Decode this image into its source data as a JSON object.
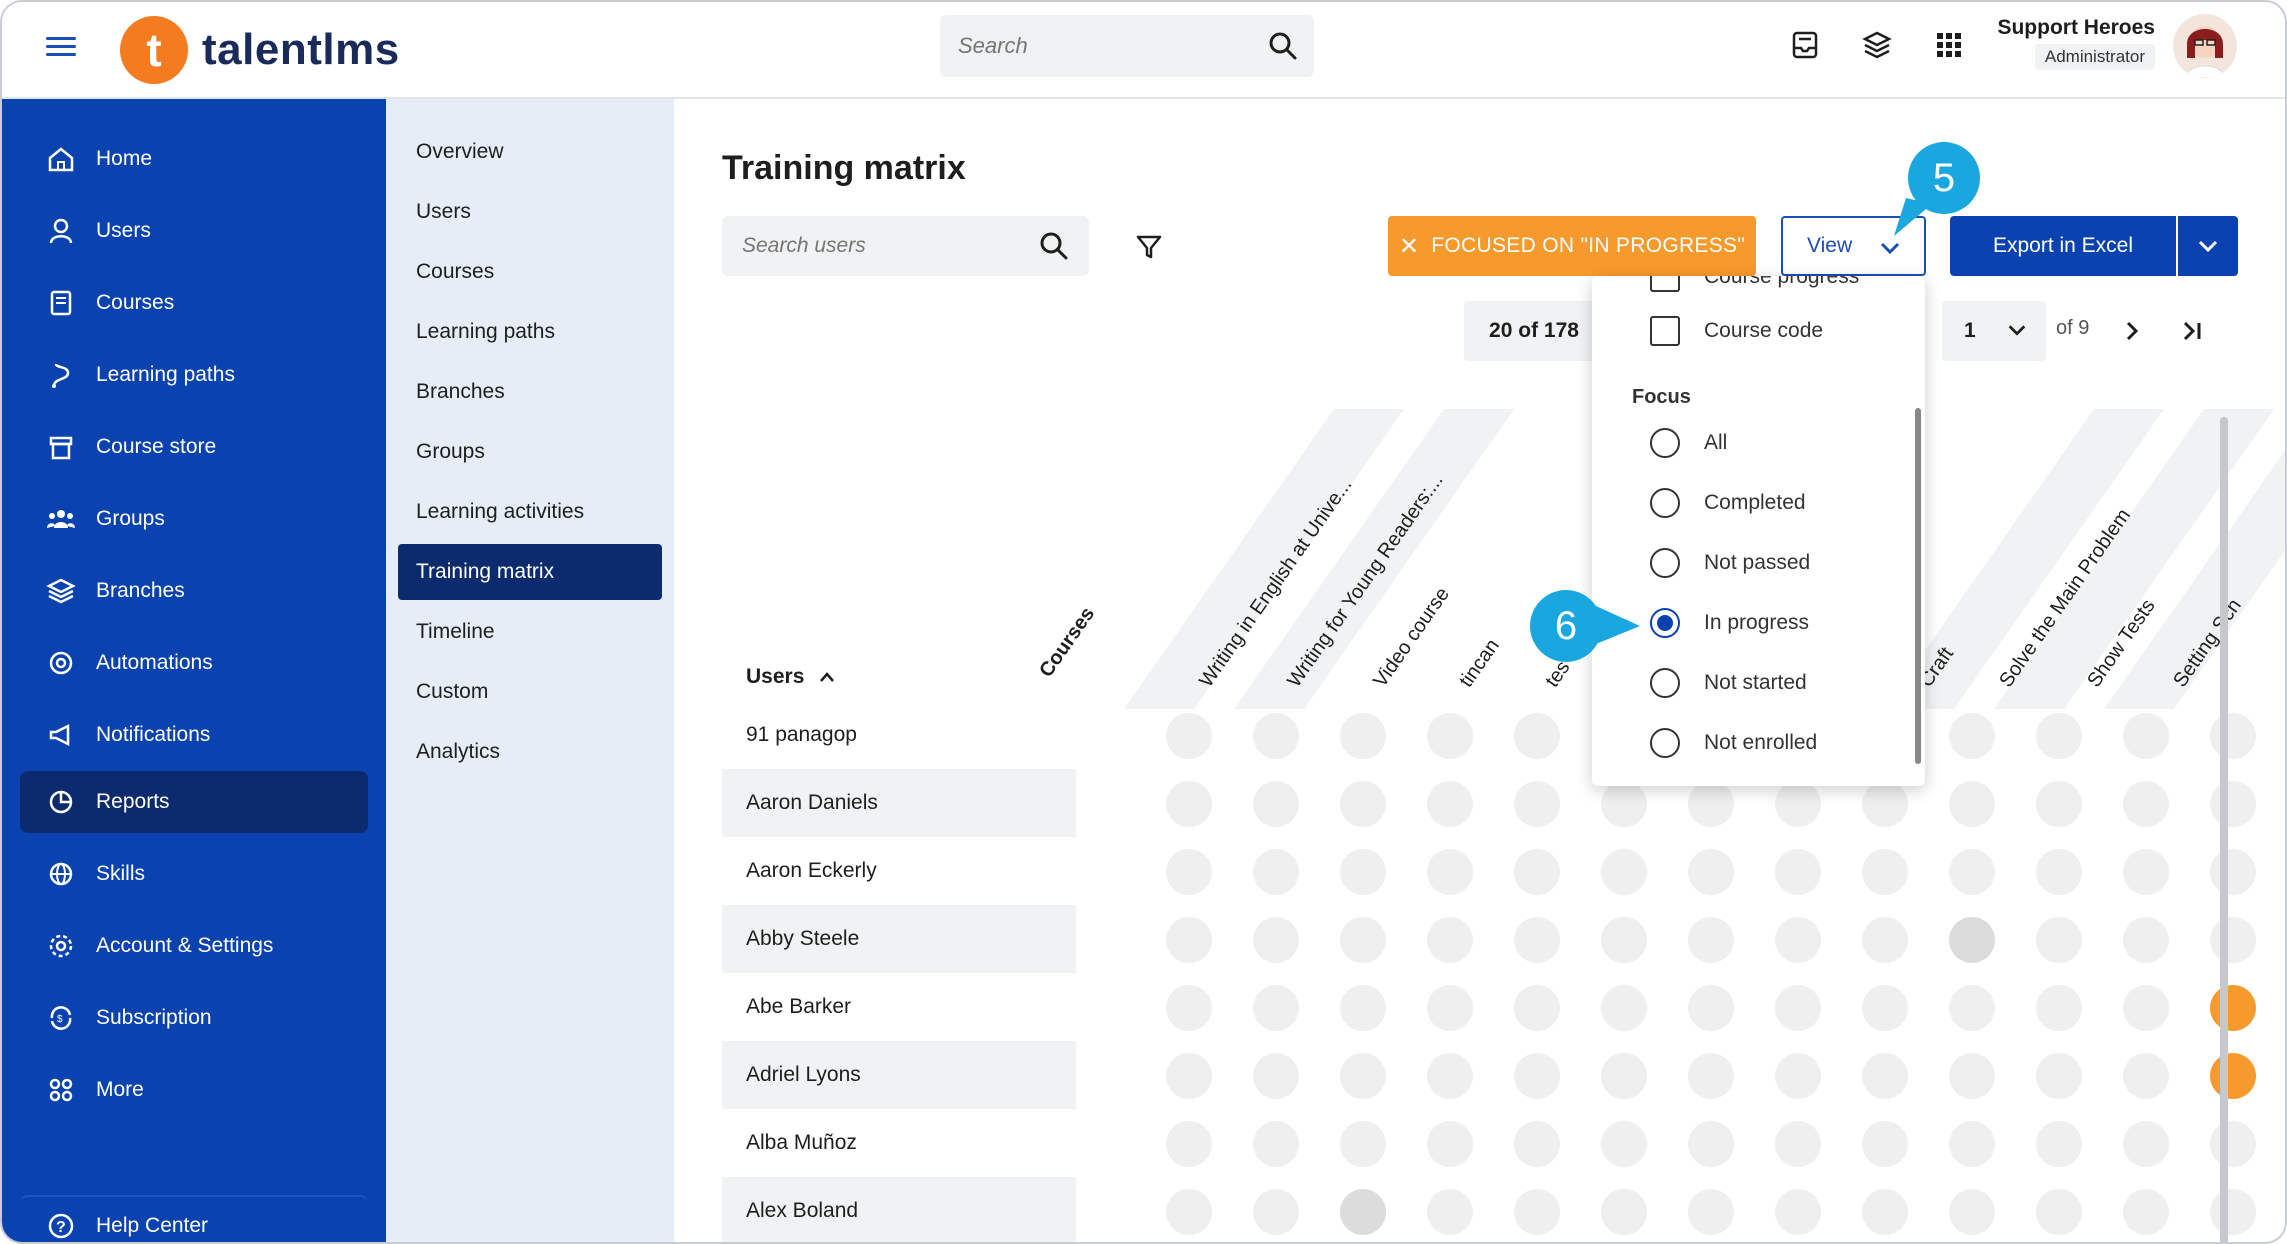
{
  "header": {
    "logo_text": "talentlms",
    "logo_mark": "t",
    "search_placeholder": "Search",
    "user_name": "Support Heroes",
    "user_role": "Administrator"
  },
  "sidebar": {
    "items": [
      {
        "label": "Home",
        "icon": "home-icon"
      },
      {
        "label": "Users",
        "icon": "user-icon"
      },
      {
        "label": "Courses",
        "icon": "book-icon"
      },
      {
        "label": "Learning paths",
        "icon": "path-icon"
      },
      {
        "label": "Course store",
        "icon": "store-icon"
      },
      {
        "label": "Groups",
        "icon": "groups-icon"
      },
      {
        "label": "Branches",
        "icon": "layers-icon"
      },
      {
        "label": "Automations",
        "icon": "automation-icon"
      },
      {
        "label": "Notifications",
        "icon": "megaphone-icon"
      },
      {
        "label": "Reports",
        "icon": "pie-chart-icon"
      },
      {
        "label": "Skills",
        "icon": "globe-icon"
      },
      {
        "label": "Account & Settings",
        "icon": "gear-icon"
      },
      {
        "label": "Subscription",
        "icon": "refresh-icon"
      },
      {
        "label": "More",
        "icon": "grid-icon"
      }
    ],
    "help_label": "Help Center"
  },
  "subnav": {
    "items": [
      "Overview",
      "Users",
      "Courses",
      "Learning paths",
      "Branches",
      "Groups",
      "Learning activities",
      "Training matrix",
      "Timeline",
      "Custom",
      "Analytics"
    ]
  },
  "main": {
    "title": "Training matrix",
    "search_placeholder": "Search users",
    "focused_label": "FOCUSED ON \"IN PROGRESS\"",
    "view_label": "View",
    "export_label": "Export in Excel",
    "count_label": "20 of 178",
    "page_value": "1",
    "of_pages": "of 9",
    "users_header": "Users",
    "courses_header": "Courses",
    "columns": [
      "Writing in English at Unive...",
      "Writing for Young Readers:...",
      "Video course",
      "tincan",
      "tes",
      "",
      "",
      "",
      "",
      "Craft",
      "Solve the Main Problem",
      "Show Tests",
      "Setting Sch"
    ],
    "users": [
      "91 panagop",
      "Aaron Daniels",
      "Aaron Eckerly",
      "Abby Steele",
      "Abe Barker",
      "Adriel Lyons",
      "Alba Muñoz",
      "Alex Boland"
    ]
  },
  "dropdown": {
    "partial_label": "Course progress",
    "course_code_label": "Course code",
    "focus_heading": "Focus",
    "options": [
      "All",
      "Completed",
      "Not passed",
      "In progress",
      "Not started",
      "Not enrolled"
    ],
    "selected": "In progress"
  },
  "callouts": {
    "five": "5",
    "six": "6"
  },
  "colors": {
    "primary": "#0a43b0",
    "nav_active": "#0b2b6e",
    "orange": "#f79a2e",
    "callout": "#1aa7e0"
  }
}
